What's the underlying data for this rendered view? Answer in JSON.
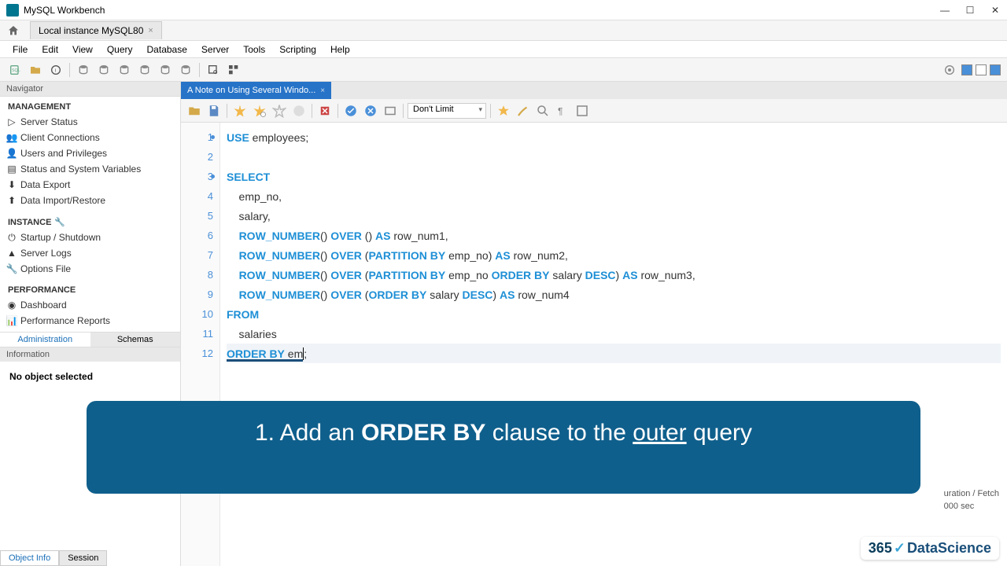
{
  "title": "MySQL Workbench",
  "connection_tab": "Local instance MySQL80",
  "menu": [
    "File",
    "Edit",
    "View",
    "Query",
    "Database",
    "Server",
    "Tools",
    "Scripting",
    "Help"
  ],
  "navigator": {
    "header": "Navigator",
    "management": {
      "title": "MANAGEMENT",
      "items": [
        "Server Status",
        "Client Connections",
        "Users and Privileges",
        "Status and System Variables",
        "Data Export",
        "Data Import/Restore"
      ]
    },
    "instance": {
      "title": "INSTANCE",
      "items": [
        "Startup / Shutdown",
        "Server Logs",
        "Options File"
      ]
    },
    "performance": {
      "title": "PERFORMANCE",
      "items": [
        "Dashboard",
        "Performance Reports"
      ]
    },
    "tabs": [
      "Administration",
      "Schemas"
    ],
    "info_header": "Information",
    "info_body": "No object selected"
  },
  "editor": {
    "tab_title": "A Note on Using Several Windo...",
    "limit": "Don't Limit",
    "lines": [
      {
        "n": 1,
        "dot": true
      },
      {
        "n": 2,
        "dot": false
      },
      {
        "n": 3,
        "dot": true
      },
      {
        "n": 4,
        "dot": false
      },
      {
        "n": 5,
        "dot": false
      },
      {
        "n": 6,
        "dot": false
      },
      {
        "n": 7,
        "dot": false
      },
      {
        "n": 8,
        "dot": false
      },
      {
        "n": 9,
        "dot": false
      },
      {
        "n": 10,
        "dot": false
      },
      {
        "n": 11,
        "dot": false
      },
      {
        "n": 12,
        "dot": false
      }
    ],
    "code": {
      "l1": {
        "kw1": "USE",
        "rest": " employees;"
      },
      "l3": {
        "kw1": "SELECT"
      },
      "l4": "    emp_no,",
      "l5": "    salary,",
      "l6": {
        "indent": "    ",
        "fn": "ROW_NUMBER",
        "p1": "() ",
        "kw2": "OVER",
        "p2": " () ",
        "kw3": "AS",
        "rest": " row_num1,"
      },
      "l7": {
        "indent": "    ",
        "fn": "ROW_NUMBER",
        "p1": "() ",
        "kw2": "OVER",
        "p2": " (",
        "kw3": "PARTITION BY",
        "mid": " emp_no) ",
        "kw4": "AS",
        "rest": " row_num2,"
      },
      "l8": {
        "indent": "    ",
        "fn": "ROW_NUMBER",
        "p1": "() ",
        "kw2": "OVER",
        "p2": " (",
        "kw3": "PARTITION BY",
        "mid": " emp_no ",
        "kw4": "ORDER BY",
        "mid2": " salary ",
        "kw5": "DESC",
        "p3": ") ",
        "kw6": "AS",
        "rest": " row_num3,"
      },
      "l9": {
        "indent": "    ",
        "fn": "ROW_NUMBER",
        "p1": "() ",
        "kw2": "OVER",
        "p2": " (",
        "kw3": "ORDER BY",
        "mid": " salary ",
        "kw4": "DESC",
        "p3": ") ",
        "kw5": "AS",
        "rest": " row_num4"
      },
      "l10": {
        "kw1": "FROM"
      },
      "l11": "    salaries",
      "l12": {
        "kw1": "ORDER BY",
        "rest": " em",
        "semi": ";"
      }
    }
  },
  "banner": {
    "prefix": "1. Add an ",
    "bold": "ORDER BY",
    "mid": " clause to the ",
    "under": "outer",
    "suffix": " query"
  },
  "watermark": {
    "num": "365",
    "brand": "DataScience"
  },
  "bottom_tabs": [
    "Object Info",
    "Session"
  ],
  "status": {
    "l1": "uration / Fetch",
    "l2": "000 sec"
  }
}
